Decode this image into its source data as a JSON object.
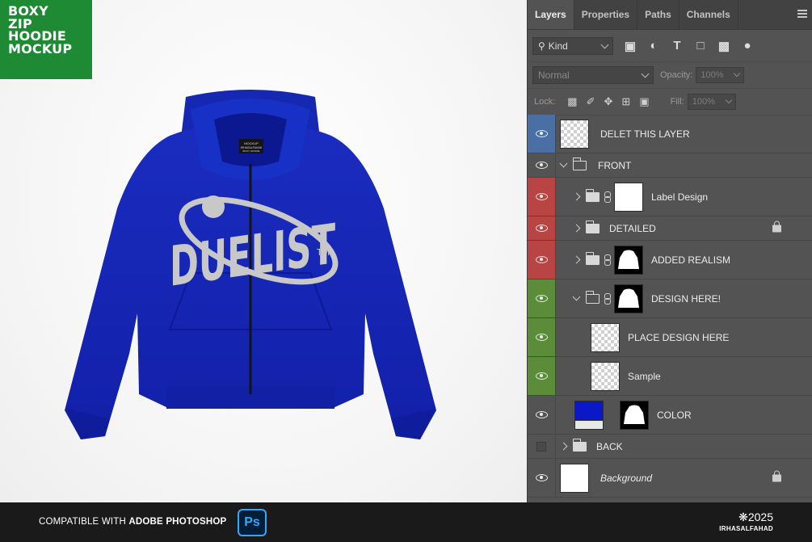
{
  "badge": {
    "lines": [
      "BOXY",
      "ZIP",
      "HOODIE",
      "MOCKUP"
    ],
    "color": "#1e8a34"
  },
  "mockup": {
    "print_text": "DUELIST",
    "trademark": "TM",
    "neck_label": [
      "MOCKUP",
      "IRHASALFAHAD",
      "BOXY HOODIE"
    ],
    "garment_color": "#1626b5"
  },
  "panel": {
    "tabs": [
      "Layers",
      "Properties",
      "Paths",
      "Channels"
    ],
    "active_tab": "Layers",
    "filter_kind": "Kind",
    "blend_mode": "Normal",
    "opacity_label": "Opacity:",
    "opacity_value": "100%",
    "lock_label": "Lock:",
    "fill_label": "Fill:",
    "fill_value": "100%",
    "layers": [
      {
        "name": "DELET THIS LAYER",
        "color_tag": "#4a6fa5",
        "visible": true
      },
      {
        "name": "FRONT",
        "visible": true
      },
      {
        "name": "Label Design",
        "color_tag": "#b84444",
        "visible": true
      },
      {
        "name": "DETAILED",
        "color_tag": "#b84444",
        "visible": true,
        "locked": true
      },
      {
        "name": "ADDED REALISM",
        "color_tag": "#b84444",
        "visible": true
      },
      {
        "name": "DESIGN HERE!",
        "color_tag": "#5b8c3a",
        "visible": true
      },
      {
        "name": "PLACE DESIGN HERE",
        "color_tag": "#5b8c3a",
        "visible": true
      },
      {
        "name": "Sample",
        "color_tag": "#5b8c3a",
        "visible": true
      },
      {
        "name": "COLOR",
        "visible": true
      },
      {
        "name": "BACK",
        "visible": false
      },
      {
        "name": "Background",
        "visible": true,
        "locked": true
      }
    ]
  },
  "footer": {
    "compat_prefix": "COMPATIBLE WITH ",
    "compat_app": "ADOBE PHOTOSHOP",
    "ps_logo": "Ps",
    "year": "❋2025",
    "author": "IRHASALFAHAD"
  }
}
